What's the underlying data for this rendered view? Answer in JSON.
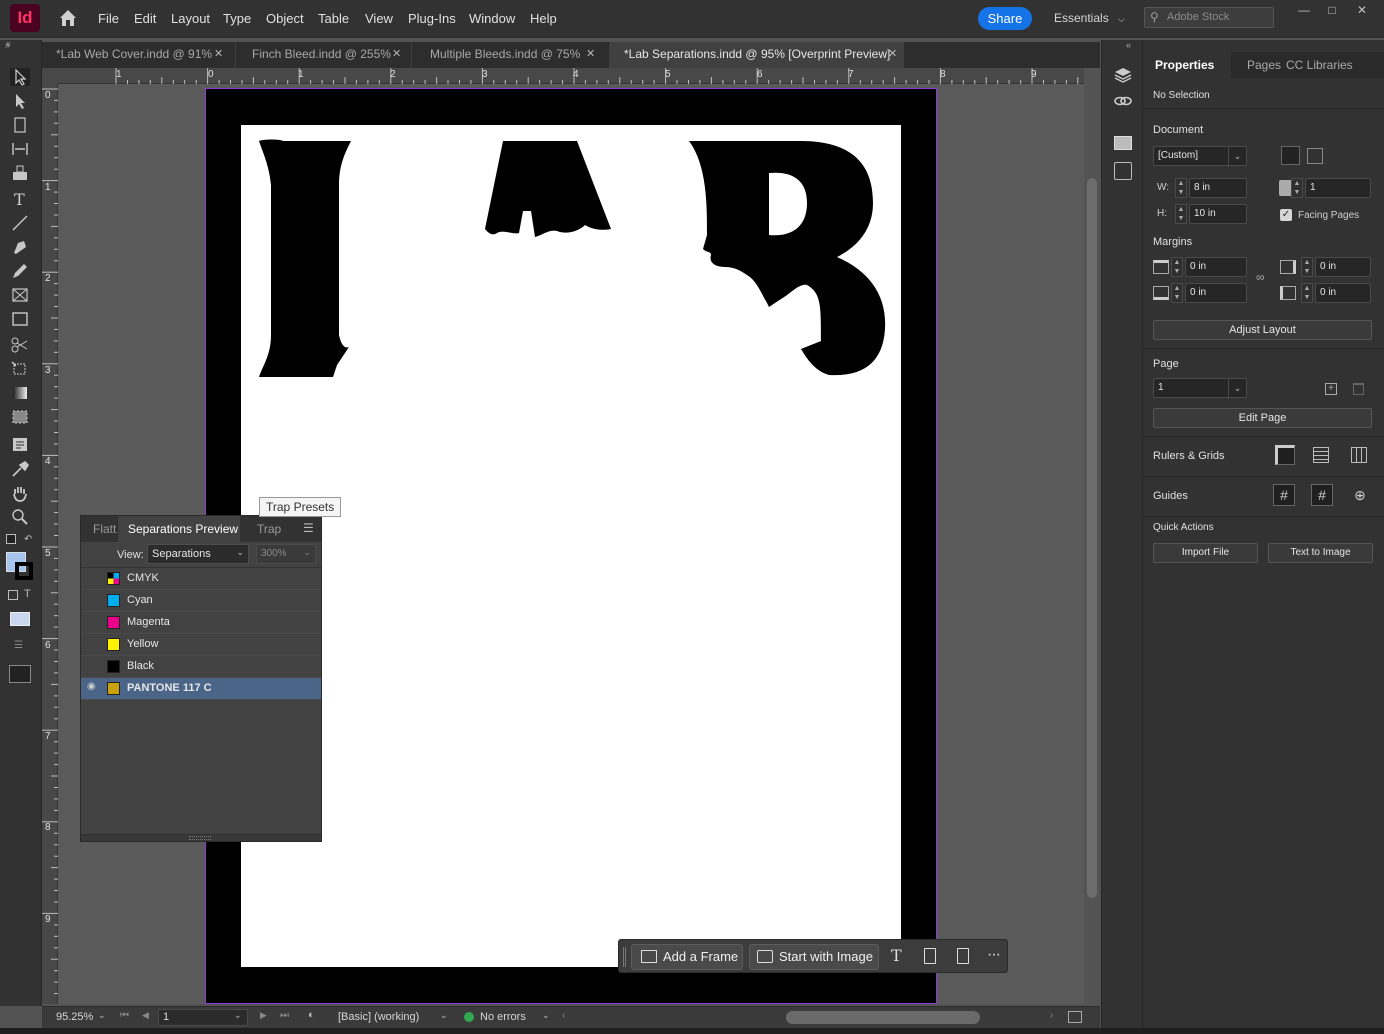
{
  "app": {
    "logo_text": "Id"
  },
  "menu": {
    "items": [
      "File",
      "Edit",
      "Layout",
      "Type",
      "Object",
      "Table",
      "View",
      "Plug-Ins",
      "Window",
      "Help"
    ]
  },
  "topbar": {
    "share_label": "Share",
    "workspace_label": "Essentials",
    "search_placeholder": "Adobe Stock"
  },
  "tabs": [
    {
      "label": "*Lab Web Cover.indd @ 91%",
      "active": false
    },
    {
      "label": "Finch Bleed.indd @ 255%",
      "active": false
    },
    {
      "label": "Multiple Bleeds.indd @ 75%",
      "active": false
    },
    {
      "label": "*Lab Separations.indd @ 95% [Overprint Preview]",
      "active": true
    }
  ],
  "ruler": {
    "top_labels": [
      "1",
      "0",
      "1",
      "2",
      "3",
      "4",
      "5",
      "6",
      "7",
      "8",
      "9"
    ],
    "left_labels": [
      "0",
      "1",
      "2",
      "3",
      "4",
      "5",
      "6",
      "7",
      "8",
      "9"
    ]
  },
  "artwork": {
    "letters": "LAB"
  },
  "separations_panel": {
    "tabs": [
      "Flatt",
      "Separations Preview",
      "Trap"
    ],
    "view_label": "View:",
    "view_value": "Separations",
    "zoom_value": "300%",
    "rows": [
      {
        "name": "CMYK",
        "color": "cmyk",
        "visible": false,
        "selected": false
      },
      {
        "name": "Cyan",
        "color": "#00aeef",
        "visible": false,
        "selected": false
      },
      {
        "name": "Magenta",
        "color": "#ec008c",
        "visible": false,
        "selected": false
      },
      {
        "name": "Yellow",
        "color": "#fff200",
        "visible": false,
        "selected": false
      },
      {
        "name": "Black",
        "color": "#000000",
        "visible": false,
        "selected": false
      },
      {
        "name": "PANTONE 117 C",
        "color": "#c9a20a",
        "visible": true,
        "selected": true
      }
    ],
    "tooltip": "Trap Presets"
  },
  "taskbar": {
    "add_frame_label": "Add a Frame",
    "start_image_label": "Start with Image"
  },
  "statusbar": {
    "zoom": "95.25%",
    "page": "1",
    "preflight_profile": "[Basic] (working)",
    "errors": "No errors"
  },
  "properties": {
    "tabs": [
      "Properties",
      "Pages",
      "CC Libraries"
    ],
    "selection": "No Selection",
    "document_label": "Document",
    "preset_value": "[Custom]",
    "width_label": "W:",
    "width_value": "8 in",
    "height_label": "H:",
    "height_value": "10 in",
    "pages_value": "1",
    "facing_pages_label": "Facing Pages",
    "margins_label": "Margins",
    "margin_top": "0 in",
    "margin_bottom": "0 in",
    "margin_left": "0 in",
    "margin_right": "0 in",
    "adjust_layout_label": "Adjust Layout",
    "page_label": "Page",
    "page_value": "1",
    "edit_page_label": "Edit Page",
    "rulers_grids_label": "Rulers & Grids",
    "guides_label": "Guides",
    "quick_actions_label": "Quick Actions",
    "import_file_label": "Import File",
    "text_to_image_label": "Text to Image"
  },
  "colors": {
    "accent": "#1473e6",
    "bleed_guide": "#8c3bd9",
    "selected_row": "#4a6587"
  }
}
